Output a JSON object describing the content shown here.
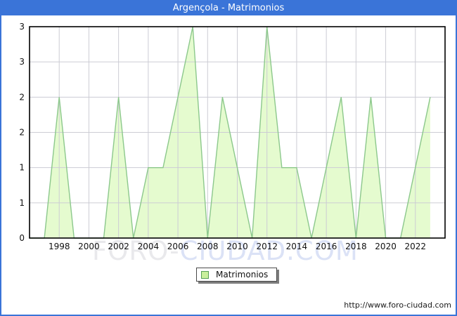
{
  "window": {
    "title": "Argençola - Matrimonios"
  },
  "chart_data": {
    "type": "area",
    "title": "Argençola - Matrimonios",
    "x": [
      1996,
      1997,
      1998,
      1999,
      2000,
      2001,
      2002,
      2003,
      2004,
      2005,
      2006,
      2007,
      2008,
      2009,
      2010,
      2011,
      2012,
      2013,
      2014,
      2015,
      2016,
      2017,
      2018,
      2019,
      2020,
      2021,
      2022,
      2023
    ],
    "series": [
      {
        "name": "Matrimonios",
        "values": [
          0,
          0,
          2,
          0,
          0,
          0,
          2,
          0,
          1,
          1,
          2,
          3,
          0,
          2,
          1,
          0,
          3,
          1,
          1,
          0,
          1,
          2,
          0,
          2,
          0,
          0,
          1,
          2
        ]
      }
    ],
    "xlim": [
      1996,
      2024
    ],
    "ylim": [
      0,
      3
    ],
    "x_tick_labels": [
      "1998",
      "2000",
      "2002",
      "2004",
      "2006",
      "2008",
      "2010",
      "2012",
      "2014",
      "2016",
      "2018",
      "2020",
      "2022"
    ],
    "y_ticks": [
      {
        "v": 0,
        "label": "0"
      },
      {
        "v": 0.5,
        "label": "1"
      },
      {
        "v": 1,
        "label": "1"
      },
      {
        "v": 1.5,
        "label": "2"
      },
      {
        "v": 2,
        "label": "2"
      },
      {
        "v": 2.5,
        "label": "3"
      },
      {
        "v": 3,
        "label": "3"
      }
    ],
    "grid": true,
    "legend_position": "bottom-center",
    "colors": {
      "titlebar": "#3a74d8",
      "border": "#3a74d8",
      "area_fill": "#e5fbcf",
      "line": "#8cc88c",
      "gridline": "#ccccd4",
      "frame": "#000000",
      "legend_swatch": "#c9f09c",
      "legend_swatch_border": "#55a055"
    }
  },
  "legend": {
    "label": "Matrimonios"
  },
  "watermark": {
    "part1": "FORO-",
    "part2": "CIUDAD.COM"
  },
  "footer": {
    "url": "http://www.foro-ciudad.com"
  }
}
